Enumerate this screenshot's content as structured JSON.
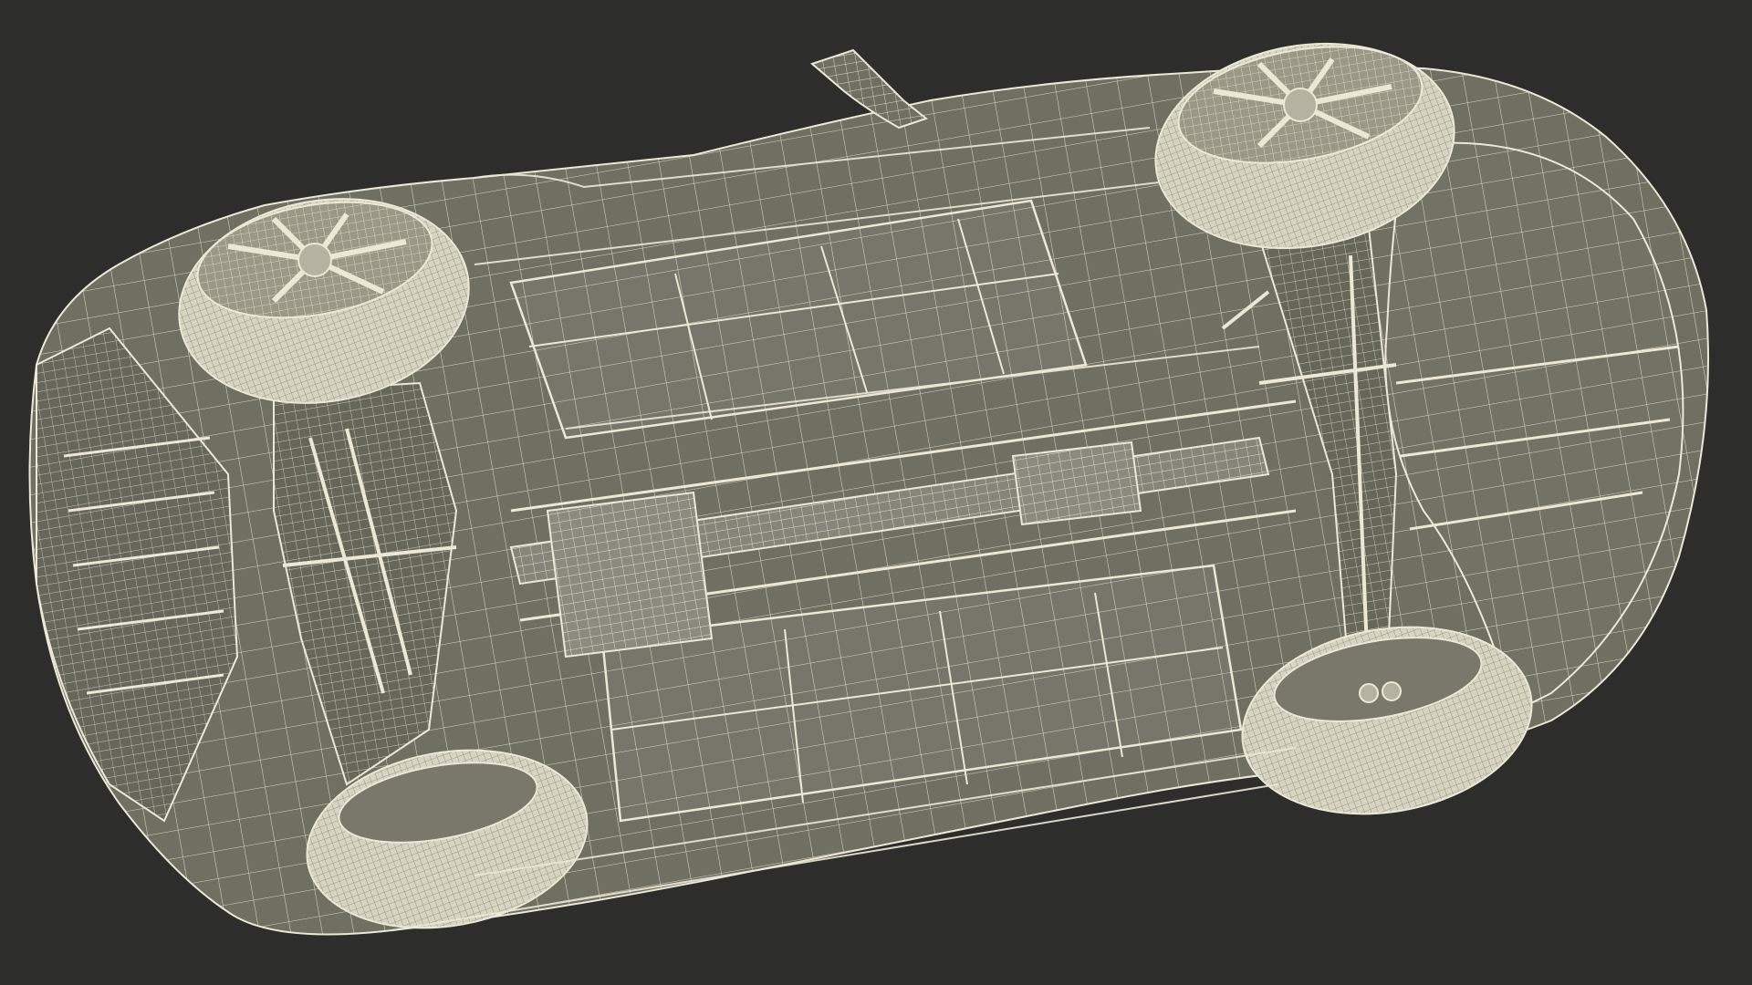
{
  "scene": {
    "subject": "car-underside-wireframe-render",
    "background_color": "#2d2d2b",
    "body_fill": "#6f6f62",
    "body_shadow": "#55554b",
    "wire_color": "#ece8d6",
    "tire_fill": "#cfcbb8",
    "rim_fill": "#8d8b7d"
  }
}
